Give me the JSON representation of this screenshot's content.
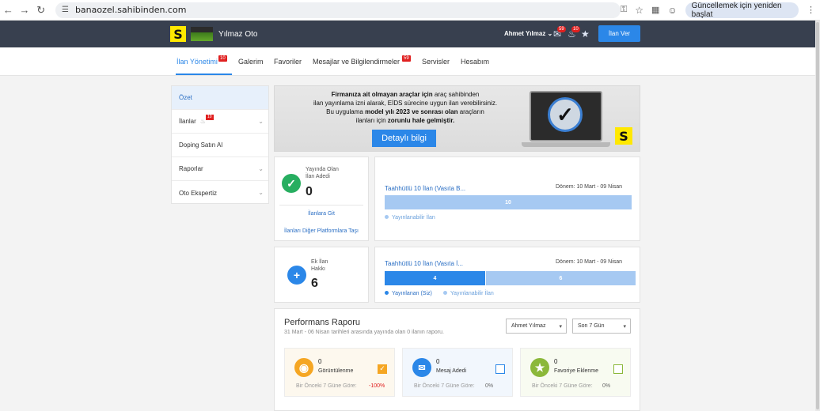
{
  "browser": {
    "url": "banaozel.sahibinden.com",
    "update_label": "Güncellemek için yeniden başlat"
  },
  "header": {
    "logo_letter": "S",
    "store_name": "Yılmaz Oto",
    "user_name": "Ahmet Yılmaz",
    "mail_badge": "59",
    "bell_badge": "10",
    "post_ad_label": "İlan Ver",
    "accent_color": "#2b87e8",
    "header_bg": "#38404f"
  },
  "tabs": [
    {
      "label": "İlan Yönetimi",
      "badge": "10",
      "active": true
    },
    {
      "label": "Galerim"
    },
    {
      "label": "Favoriler"
    },
    {
      "label": "Mesajlar ve Bilgilendirmeler",
      "badge": "59"
    },
    {
      "label": "Servisler"
    },
    {
      "label": "Hesabım"
    }
  ],
  "sidebar": {
    "items": [
      {
        "label": "Özet",
        "active": true
      },
      {
        "label": "İlanlar",
        "badge": "10"
      },
      {
        "label": "Doping Satın Al"
      },
      {
        "label": "Raporlar"
      },
      {
        "label": "Oto Ekspertiz"
      }
    ]
  },
  "banner": {
    "line1_bold": "Firmanıza ait olmayan araçlar için",
    "line1_rest": " araç sahibinden",
    "line2": "ilan yayınlama izni alarak, EİDS sürecine uygun ilan verebilirsiniz.",
    "line3_pre": "Bu uygulama ",
    "line3_bold": "model yılı 2023 ve sonrası olan",
    "line3_rest": " araçların",
    "line4_pre": "ilanları için ",
    "line4_bold": "zorunlu hale gelmiştir.",
    "button_label": "Detaylı bilgi",
    "logo_letter": "S"
  },
  "published_card": {
    "label_line1": "Yayında Olan",
    "label_line2": "İlan Adedi",
    "count": "0",
    "link1": "İlanlara Git",
    "link2": "İlanları Diğer Platformlara Taşı"
  },
  "extra_card": {
    "label_line1": "Ek İlan",
    "label_line2": "Hakkı",
    "count": "6"
  },
  "package1": {
    "title": "Taahhütlü 10 İlan (Vasıta B...",
    "period": "Dönem: 10 Mart - 09 Nisan",
    "bar_total": 10,
    "available_value": 10,
    "available_label": "10",
    "legend_available": "Yayınlanabilir İlan"
  },
  "package2": {
    "title": "Taahhütlü 10 İlan (Vasıta İ...",
    "period": "Dönem: 10 Mart - 09 Nisan",
    "bar_total": 10,
    "published_value": 4,
    "published_label": "4",
    "available_value": 6,
    "available_label": "6",
    "legend_published": "Yayınlanan (Siz)",
    "legend_available": "Yayınlanabilir İlan"
  },
  "performance": {
    "title": "Performans Raporu",
    "subtitle": "31 Mart - 06 Nisan tarihleri arasında yayında olan 0 ilanın raporu.",
    "user_select": "Ahmet Yılmaz",
    "period_select": "Son 7 Gün",
    "stats": [
      {
        "value": "0",
        "label": "Görüntülenme",
        "prev_label": "Bir Önceki 7 Güne Göre:",
        "change": "-100%",
        "color": "#f5a623",
        "icon": "eye-icon"
      },
      {
        "value": "0",
        "label": "Mesaj Adedi",
        "prev_label": "Bir Önceki 7 Güne Göre:",
        "change": "0%",
        "color": "#2b87e8",
        "icon": "mail-icon"
      },
      {
        "value": "0",
        "label": "Favoriye Eklenme",
        "prev_label": "Bir Önceki 7 Güne Göre:",
        "change": "0%",
        "color": "#8bb83a",
        "icon": "star-icon"
      }
    ]
  }
}
